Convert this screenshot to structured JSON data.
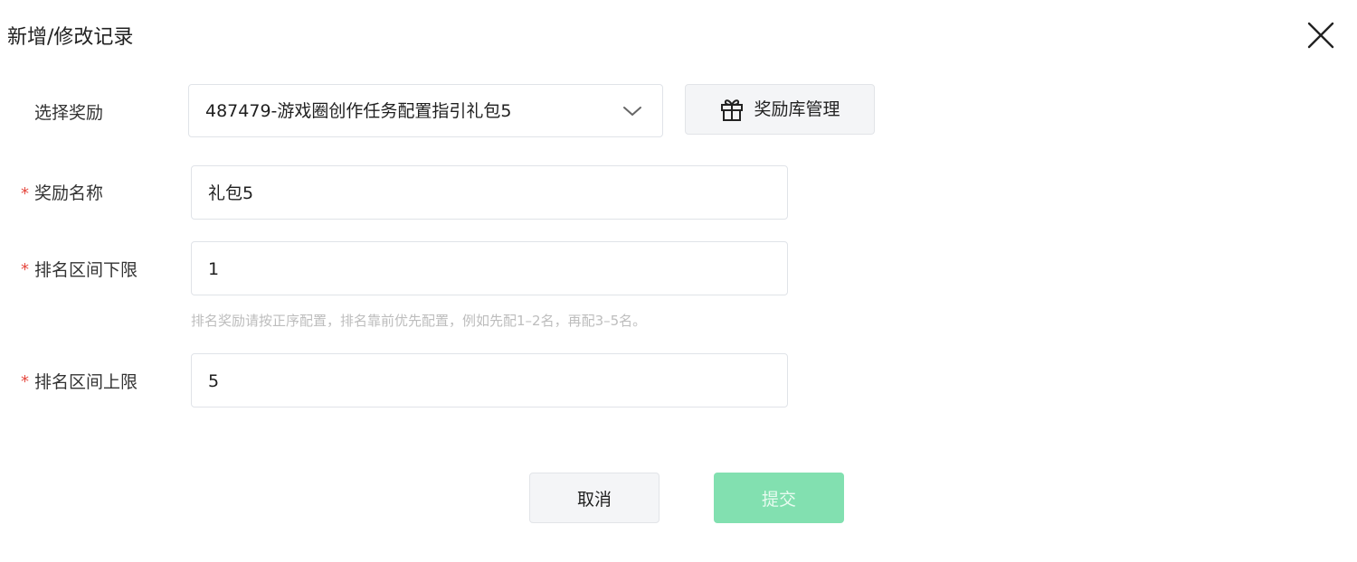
{
  "dialog": {
    "title": "新增/修改记录"
  },
  "form": {
    "reward_select": {
      "label": "选择奖励",
      "value": "487479-游戏圈创作任务配置指引礼包5"
    },
    "reward_library_button": {
      "label": "奖励库管理"
    },
    "reward_name": {
      "required_mark": "*",
      "label": "奖励名称",
      "value": "礼包5"
    },
    "rank_lower": {
      "required_mark": "*",
      "label": "排名区间下限",
      "value": "1",
      "hint": "排名奖励请按正序配置，排名靠前优先配置，例如先配1–2名，再配3–5名。"
    },
    "rank_upper": {
      "required_mark": "*",
      "label": "排名区间上限",
      "value": "5"
    }
  },
  "footer": {
    "cancel_label": "取消",
    "submit_label": "提交"
  },
  "colors": {
    "required": "#e5483f",
    "submit_disabled_bg": "#82e0b0",
    "hint_text": "#bdbdbd"
  },
  "icons": {
    "close": "close-icon",
    "dropdown": "chevron-down-icon",
    "library": "gift-icon"
  }
}
